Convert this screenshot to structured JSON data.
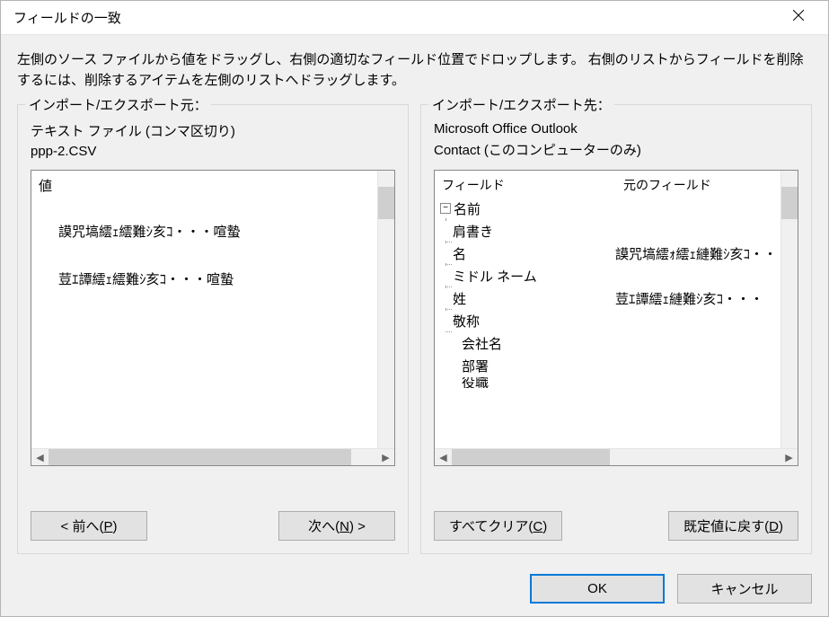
{
  "title": "フィールドの一致",
  "instructions": "左側のソース ファイルから値をドラッグし、右側の適切なフィールド位置でドロップします。 右側のリストからフィールドを削除するには、削除するアイテムを左側のリストへドラッグします。",
  "source": {
    "legend": "インポート/エクスポート元：",
    "format": "テキスト ファイル (コンマ区切り)",
    "filename": "ppp-2.CSV",
    "header": "値",
    "items": [
      "謨咒塙繧ｪ繧難ｼ亥ｺ・・・喧蟄",
      "荳ｴ譚繧ｪ繧難ｼ亥ｺ・・・喧蟄"
    ]
  },
  "target": {
    "legend": "インポート/エクスポート先：",
    "app": "Microsoft Office Outlook",
    "folder": "Contact (このコンピューターのみ)",
    "header_field": "フィールド",
    "header_source": "元のフィールド",
    "rows": [
      {
        "label": "名前",
        "level": 0,
        "expandable": true
      },
      {
        "label": "肩書き",
        "level": 1,
        "mapped": ""
      },
      {
        "label": "名",
        "level": 1,
        "mapped": "謨咒塙繧ｫ繧ｪ縺難ｼ亥ｺ・・"
      },
      {
        "label": "ミドル ネーム",
        "level": 1,
        "mapped": ""
      },
      {
        "label": "姓",
        "level": 1,
        "mapped": "荳ｴ譚繧ｪ縺難ｼ亥ｺ・・・"
      },
      {
        "label": "敬称",
        "level": 1,
        "mapped": "",
        "last": true
      },
      {
        "label": "会社名",
        "level": 2,
        "mapped": ""
      },
      {
        "label": "部署",
        "level": 2,
        "mapped": ""
      },
      {
        "label": "役職",
        "level": 2,
        "mapped": ""
      }
    ]
  },
  "buttons": {
    "prev": "< 前へ(P)",
    "next": "次へ(N) >",
    "clear": "すべてクリア(C)",
    "reset": "既定値に戻す(D)",
    "ok": "OK",
    "cancel": "キャンセル"
  }
}
